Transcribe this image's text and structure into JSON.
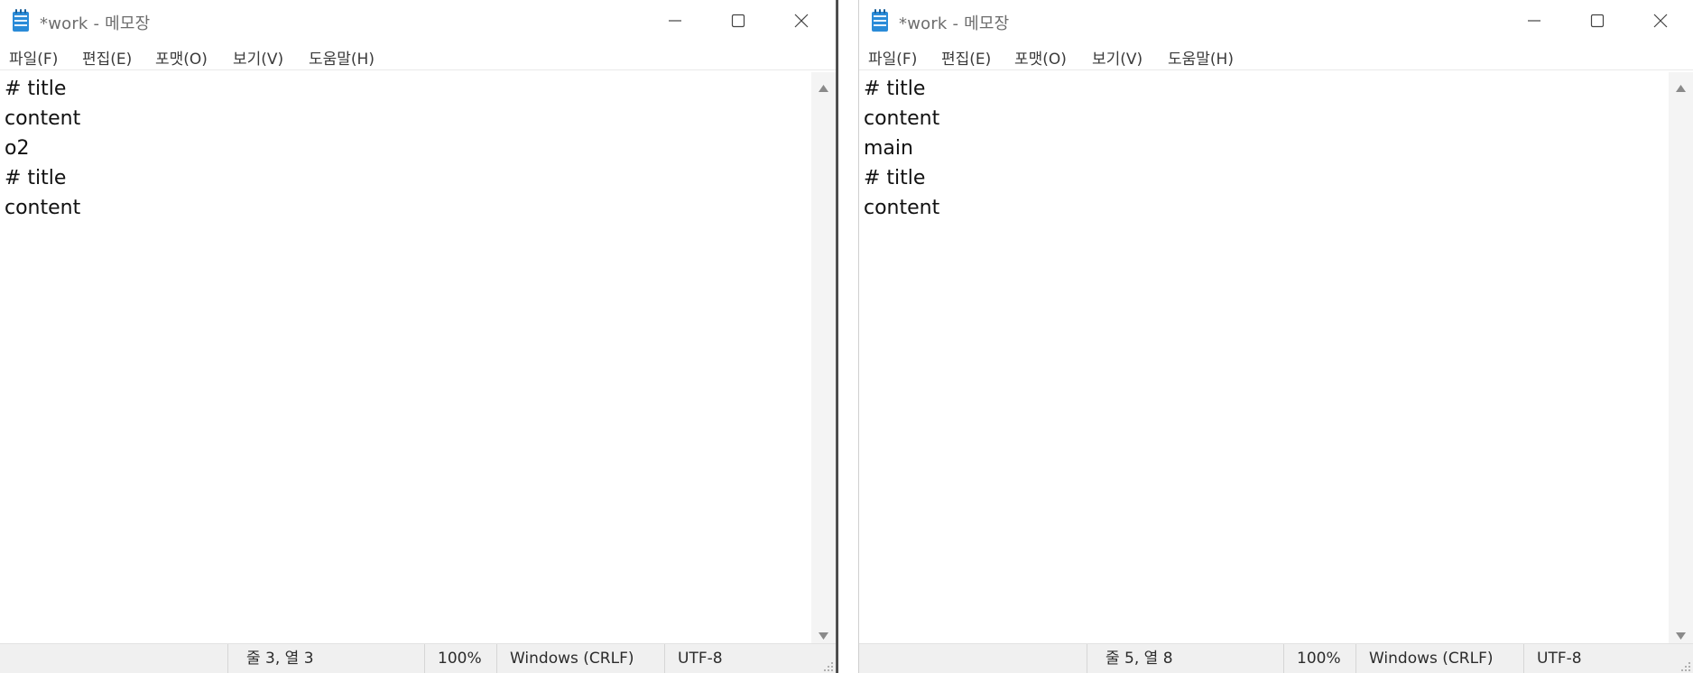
{
  "windows": [
    {
      "title": "*work - 메모장",
      "menu": [
        "파일(F)",
        "편집(E)",
        "포맷(O)",
        "보기(V)",
        "도움말(H)"
      ],
      "lines": [
        "# title",
        "content",
        "o2",
        "# title",
        "content"
      ],
      "status": {
        "position": "줄 3, 열 3",
        "zoom": "100%",
        "line_ending": "Windows (CRLF)",
        "encoding": "UTF-8"
      }
    },
    {
      "title": "*work - 메모장",
      "menu": [
        "파일(F)",
        "편집(E)",
        "포맷(O)",
        "보기(V)",
        "도움말(H)"
      ],
      "lines": [
        "# title",
        "content",
        "main",
        "# title",
        "content"
      ],
      "status": {
        "position": "줄 5, 열 8",
        "zoom": "100%",
        "line_ending": "Windows (CRLF)",
        "encoding": "UTF-8"
      }
    }
  ],
  "icons": {
    "app": "notepad-icon",
    "minimize": "minimize-icon",
    "maximize": "maximize-icon",
    "close": "close-icon",
    "scroll_up": "scroll-up-arrow-icon",
    "scroll_down": "scroll-down-arrow-icon",
    "grip": "resize-grip-icon"
  },
  "colors": {
    "app_icon": "#2a8bd8",
    "title_text": "#6d6d6d",
    "status_bg": "#f0f0f0"
  }
}
